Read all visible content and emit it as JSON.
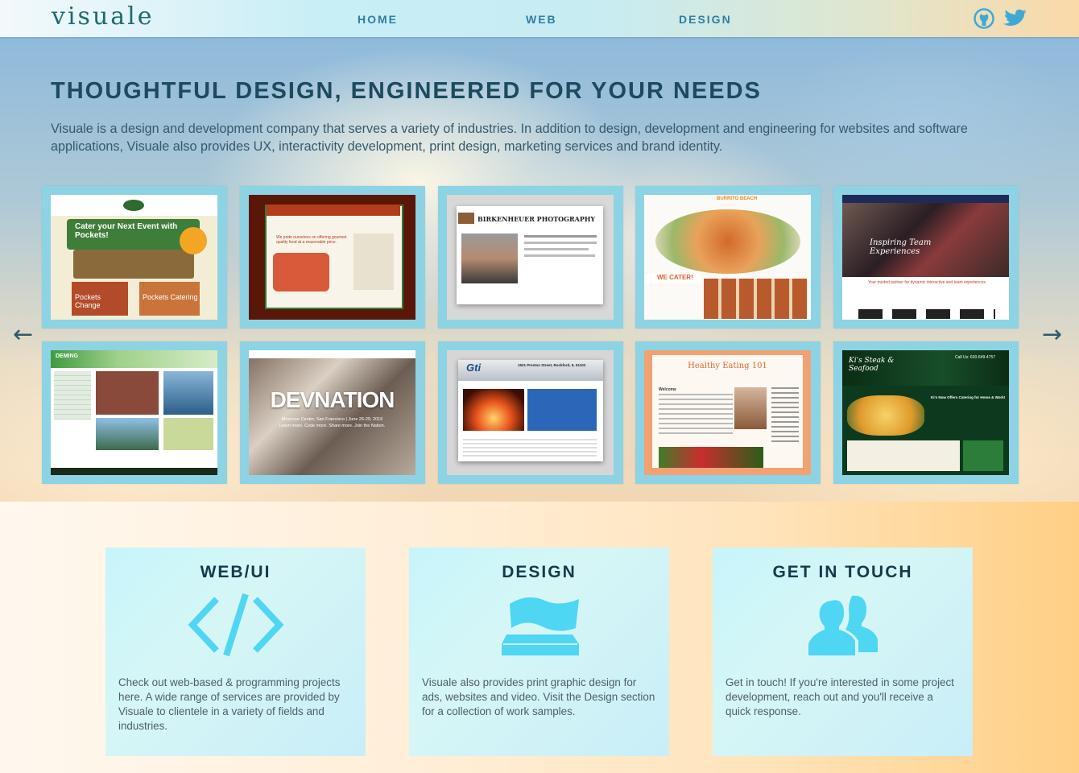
{
  "nav": {
    "logo": "visuale",
    "links": [
      "HOME",
      "WEB",
      "DESIGN"
    ],
    "icons": [
      "github-icon",
      "twitter-icon"
    ]
  },
  "hero": {
    "title": "THOUGHTFUL DESIGN, ENGINEERED FOR YOUR NEEDS",
    "text": "Visuale is a design and development company that serves a variety of industries. In addition to design, development and engineering for websites and software applications, Visuale also provides UX, interactivity development, print design, marketing services and brand identity."
  },
  "carousel": {
    "prev_arrow": "←",
    "next_arrow": "→",
    "thumbs": [
      {
        "headline": "Cater your Next Event with Pockets!",
        "sub1": "Pockets Change",
        "sub2": "Pockets Catering"
      },
      {
        "headline": "We pride ourselves on offering gourmet quality food at a reasonable price."
      },
      {
        "headline": "BIRKENHEUER PHOTOGRAPHY"
      },
      {
        "headline": "BURRITO BEACH",
        "sub1": "WE CATER!"
      },
      {
        "headline": "Inspiring Team Experiences",
        "sub1": "Your trusted partner for dynamic interactive and team experiences"
      },
      {
        "headline": "DEMING"
      },
      {
        "headline": "DEVNATION",
        "sub1": "Moscone Center, San Francisco | June 26-29, 2016",
        "sub2": "Learn more. Code more. Share more. Join the Nation."
      },
      {
        "headline": "Gti",
        "sub1": "1521 Preston Street, Rockford, IL 61102"
      },
      {
        "headline": "Healthy Eating 101",
        "sub1": "Welcome"
      },
      {
        "headline": "Ki's Steak & Seafood",
        "sub1": "Call Us: 630-649-4757",
        "sub2": "Ki's Now Offers Catering for Home & Work!"
      }
    ]
  },
  "cards": [
    {
      "title": "WEB/UI",
      "icon": "code-icon",
      "text": "Check out web-based & programming projects here. A wide range of services are provided by Visuale to clientele in a variety of fields and industries."
    },
    {
      "title": "DESIGN",
      "icon": "print-layers-icon",
      "text": "Visuale also provides print graphic design for ads, websites and video. Visit the Design section for a collection of work samples."
    },
    {
      "title": "GET IN TOUCH",
      "icon": "users-icon",
      "text": "Get in touch! If you're interested in some project development, reach out and you'll receive a quick response."
    }
  ],
  "colors": {
    "accent": "#4fd6f2",
    "title": "#16394a",
    "nav_link": "#2f7ea2"
  }
}
